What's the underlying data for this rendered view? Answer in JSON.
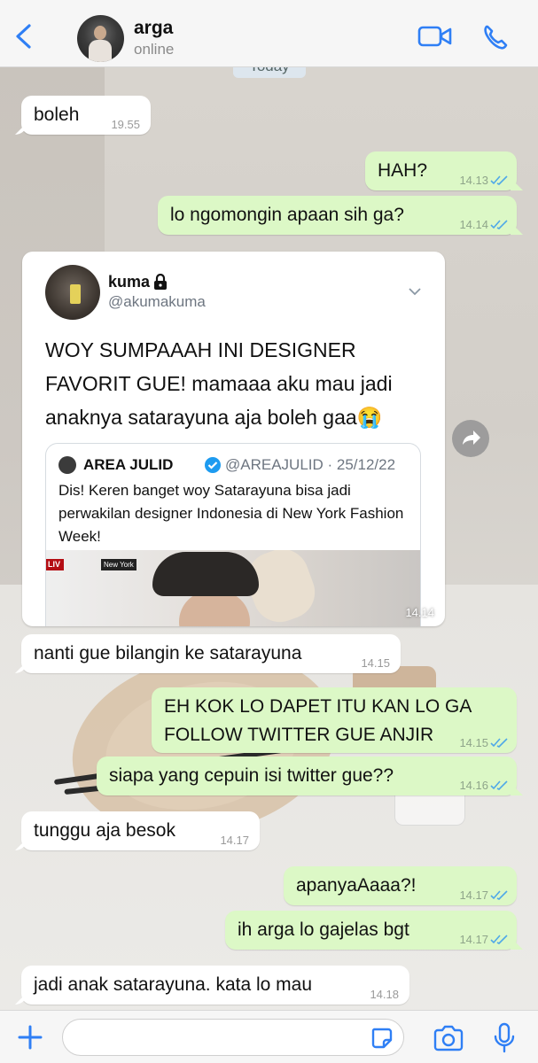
{
  "header": {
    "back_icon": "chevron-left-icon",
    "contact_name": "arga",
    "status": "online",
    "video_icon": "video-call-icon",
    "phone_icon": "phone-icon"
  },
  "date_separator": "Today",
  "messages": [
    {
      "direction": "in",
      "text": "boleh",
      "time": "19.55"
    },
    {
      "direction": "out",
      "text": "HAH?",
      "time": "14.13",
      "read": true
    },
    {
      "direction": "out",
      "text": "lo ngomongin apaan sih ga?",
      "time": "14.14",
      "read": true
    },
    {
      "direction": "in",
      "type": "tweet",
      "time": "14.14"
    },
    {
      "direction": "in",
      "text": "nanti gue bilangin ke satarayuna",
      "time": "14.15"
    },
    {
      "direction": "out",
      "text": "EH KOK LO DAPET ITU KAN LO GA FOLLOW TWITTER GUE ANJIR",
      "time": "14.15",
      "read": true
    },
    {
      "direction": "out",
      "text": "siapa yang cepuin isi twitter gue??",
      "time": "14.16",
      "read": true
    },
    {
      "direction": "in",
      "text": "tunggu aja besok",
      "time": "14.17"
    },
    {
      "direction": "out",
      "text": "apanyaAaaa?!",
      "time": "14.17",
      "read": true
    },
    {
      "direction": "out",
      "text": "ih arga lo gajelas bgt",
      "time": "14.17",
      "read": true
    },
    {
      "direction": "in",
      "text": "jadi anak satarayuna. kata lo mau",
      "time": "14.18"
    }
  ],
  "tweet": {
    "name": "kuma",
    "handle": "@akumakuma",
    "text": "WOY SUMPAAAH INI DESIGNER FAVORIT GUE! mamaaa aku mau jadi anaknya satarayuna aja boleh gaa😭",
    "time": "14.14",
    "quote": {
      "name": "AREA JULID",
      "handle_date": "@AREAJULID · 25/12/22",
      "text": "Dis! Keren banget woy Satarayuna bisa jadi perwakilan designer Indonesia di New York Fashion Week!",
      "live_label": "LIV",
      "live_location": "New York"
    }
  },
  "input_bar": {
    "plus_icon": "plus-icon",
    "sticker_icon": "sticker-icon",
    "camera_icon": "camera-icon",
    "mic_icon": "microphone-icon"
  },
  "colors": {
    "accent": "#2f7ff5",
    "outgoing_bubble": "#dcf8c6",
    "incoming_bubble": "#ffffff",
    "read_ticks": "#4fa8e8"
  }
}
